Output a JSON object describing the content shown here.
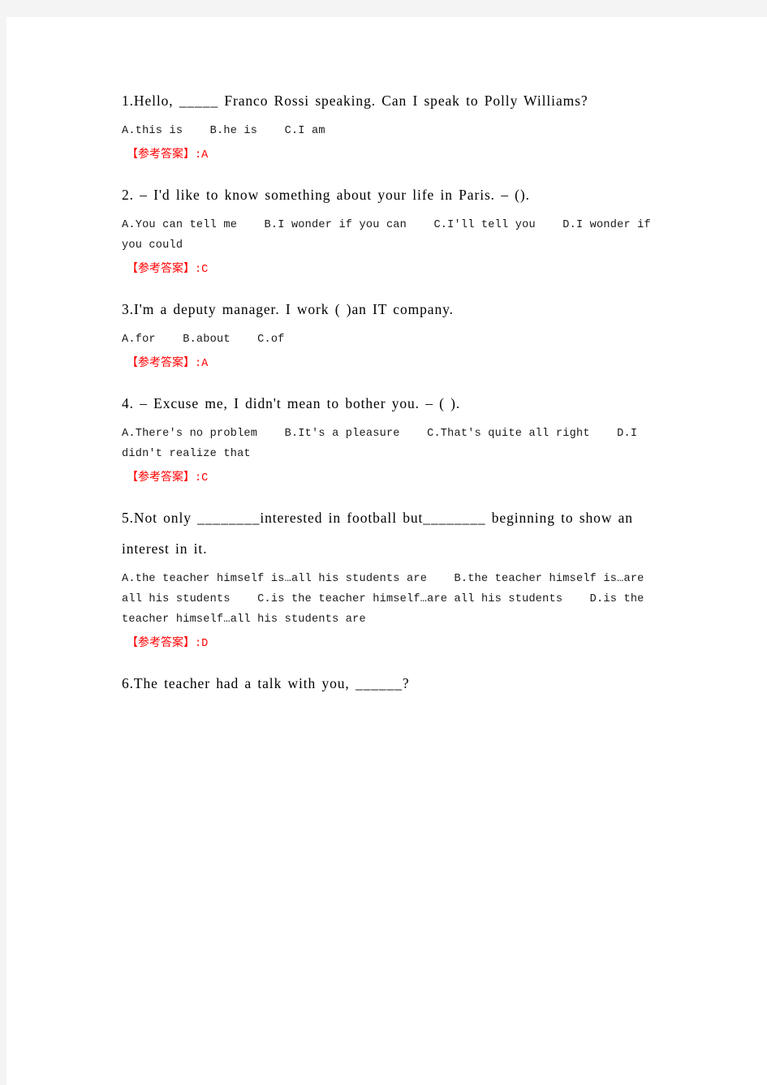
{
  "page": {
    "background_color": "#ffffff",
    "gutter_color": "#f4f4f4",
    "answer_color": "#ff0000",
    "text_color": "#000000"
  },
  "answer_label": "【参考答案】",
  "answer_separator": ":",
  "questions": [
    {
      "number": "1.",
      "stem": "1.Hello, _____ Franco Rossi speaking. Can I speak to Polly Williams?",
      "options": "A.this is    B.he is    C.I am",
      "answer_tag": "【参考答案】",
      "answer_sep": ":",
      "answer": "A"
    },
    {
      "number": "2.",
      "stem": "2. – I'd like to know something about your life in Paris. – ().",
      "options": "A.You can tell me    B.I wonder if you can    C.I'll tell you    D.I wonder if you could",
      "answer_tag": "【参考答案】",
      "answer_sep": ":",
      "answer": "C"
    },
    {
      "number": "3.",
      "stem": "3.I'm a deputy manager. I work ( )an IT company.",
      "options": "A.for    B.about    C.of",
      "answer_tag": "【参考答案】",
      "answer_sep": ":",
      "answer": "A"
    },
    {
      "number": "4.",
      "stem": "4. – Excuse me, I didn't mean to bother you. – ( ).",
      "options": "A.There's no problem    B.It's a pleasure    C.That's quite all right    D.I didn't realize that",
      "answer_tag": "【参考答案】",
      "answer_sep": ":",
      "answer": "C"
    },
    {
      "number": "5.",
      "stem": "5.Not only ________interested in football but________ beginning to show an interest in it.",
      "options": "A.the teacher himself is…all his students are    B.the teacher himself is…are all his students    C.is the teacher himself…are all his students    D.is the teacher himself…all his students are",
      "answer_tag": "【参考答案】",
      "answer_sep": ":",
      "answer": "D"
    },
    {
      "number": "6.",
      "stem": "6.The teacher had a talk with you, ______?",
      "options": "",
      "answer_tag": "",
      "answer_sep": "",
      "answer": ""
    }
  ]
}
